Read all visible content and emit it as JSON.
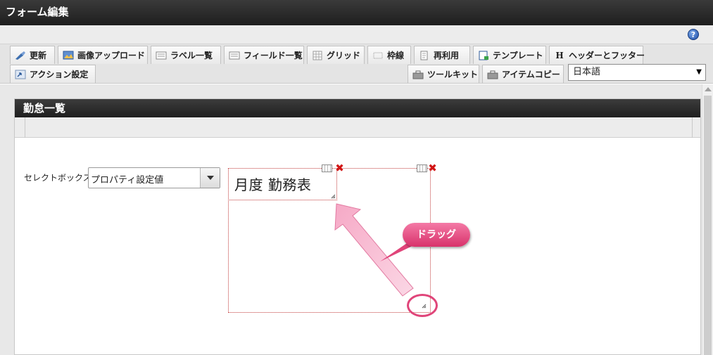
{
  "window": {
    "title": "フォーム編集"
  },
  "toolbar": {
    "tabs_row1": [
      {
        "label": "更新",
        "icon": "update-icon"
      },
      {
        "label": "画像アップロード",
        "icon": "image-upload-icon"
      },
      {
        "label": "ラベル一覧",
        "icon": "label-list-icon"
      },
      {
        "label": "フィールド一覧",
        "icon": "field-list-icon"
      },
      {
        "label": "グリッド",
        "icon": "grid-icon"
      },
      {
        "label": "枠線",
        "icon": "border-icon"
      },
      {
        "label": "再利用",
        "icon": "reuse-icon"
      },
      {
        "label": "テンプレート",
        "icon": "template-icon"
      },
      {
        "label": "ヘッダーとフッター",
        "icon": "header-footer-icon",
        "glyph": "H"
      }
    ],
    "tabs_row2": [
      {
        "label": "アクション設定",
        "icon": "action-settings-icon"
      },
      {
        "label": "ツールキット",
        "icon": "toolkit-icon"
      },
      {
        "label": "アイテムコピー",
        "icon": "item-copy-icon"
      }
    ],
    "language": {
      "selected": "日本語",
      "arrow": "▼"
    }
  },
  "help": {
    "icon": "help-icon",
    "glyph": "?"
  },
  "form": {
    "title": "勤怠一覧",
    "select_label": "セレクトボックス",
    "select_value": "プロパティ設定値",
    "label_text": "月度 勤務表",
    "delete_glyph": "✖"
  },
  "annotation": {
    "callout": "ドラッグ",
    "color": "#e0457a"
  }
}
